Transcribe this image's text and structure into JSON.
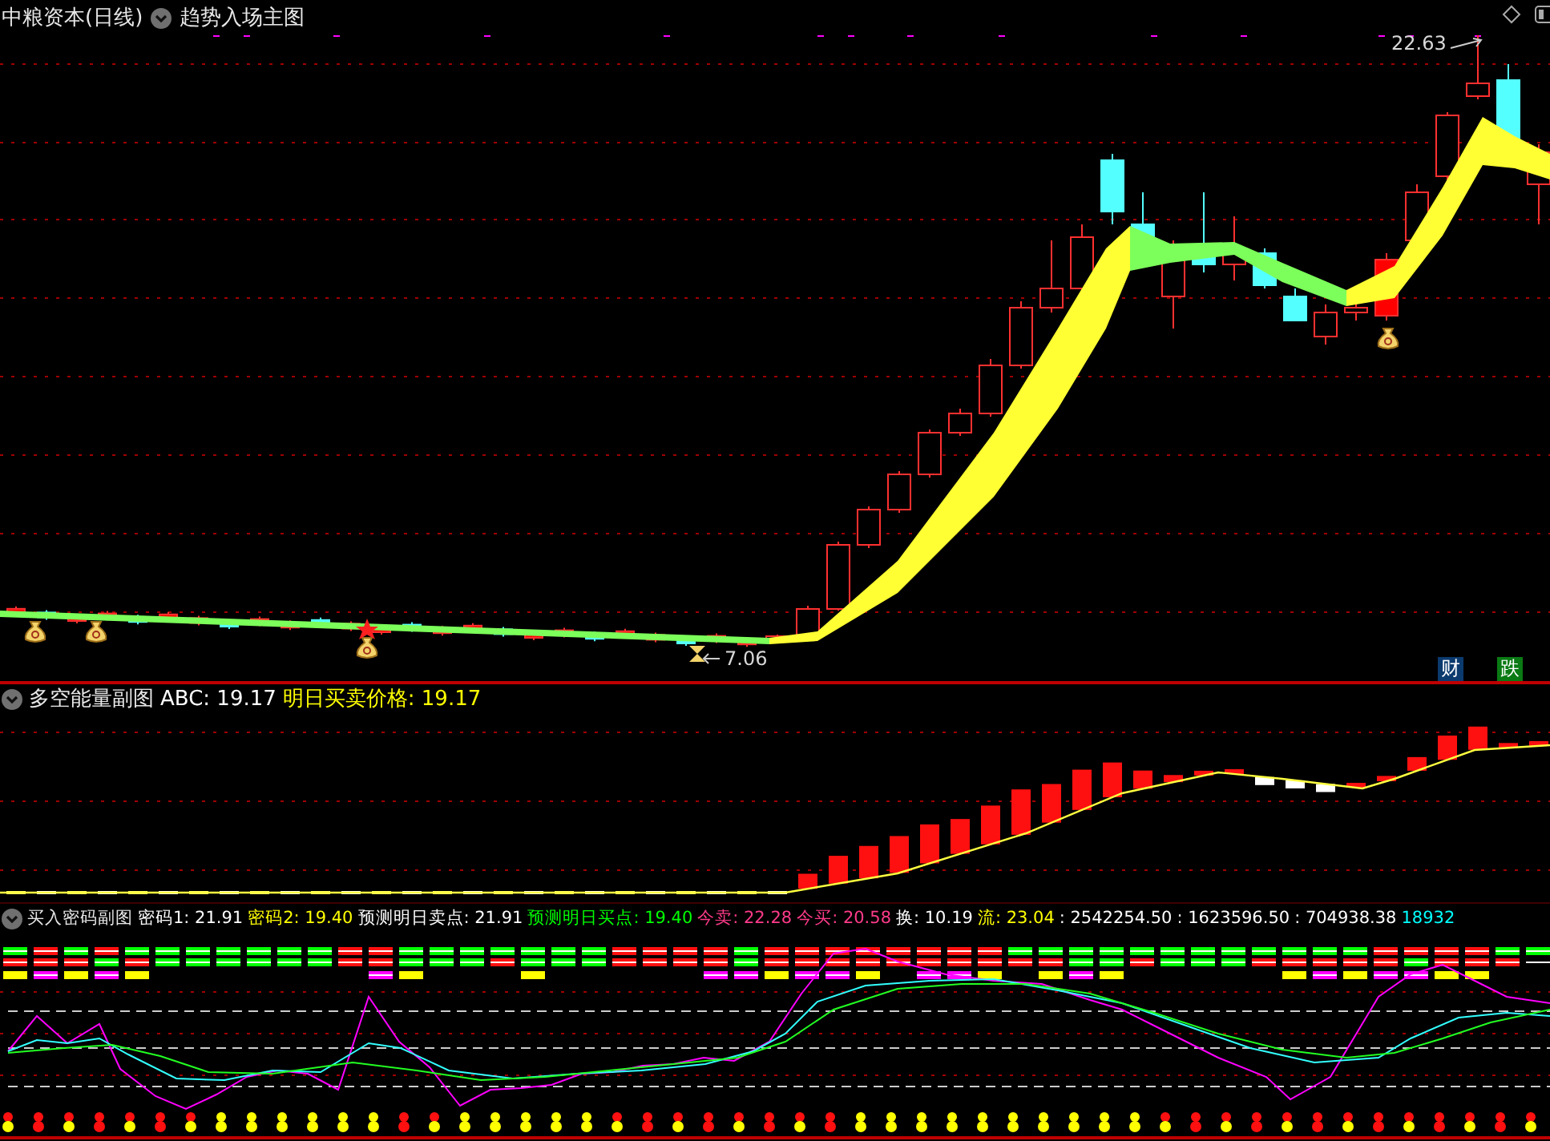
{
  "main_pane": {
    "stock_title": "中粮资本(日线)",
    "indicator": "趋势入场主图",
    "price_labels": [
      {
        "text": "22.63",
        "kind": "high"
      },
      {
        "text": "7.06",
        "kind": "low"
      }
    ],
    "badges": [
      {
        "text": "财",
        "color": "#0b3a6e"
      },
      {
        "text": "跌",
        "color": "#0a7a14"
      }
    ]
  },
  "sub_pane_1": {
    "indicator": "多空能量副图",
    "values": [
      {
        "text": "ABC: 19.17",
        "color": "#ffffff"
      },
      {
        "text": "明日买卖价格: 19.17",
        "color": "#ffff00"
      }
    ]
  },
  "sub_pane_2": {
    "indicator": "买入密码副图",
    "values": [
      {
        "text": "密码1: 21.91",
        "color": "#ffffff"
      },
      {
        "text": "密码2: 19.40",
        "color": "#ffff00"
      },
      {
        "text": "预测明日卖点: 21.91",
        "color": "#ffffff"
      },
      {
        "text": "预测明日买点: 19.40",
        "color": "#00ff00"
      },
      {
        "text": "今卖: 22.28",
        "color": "#ff3b8a"
      },
      {
        "text": "今买: 20.58",
        "color": "#ff3b8a"
      },
      {
        "text": "换: 10.19",
        "color": "#ffffff"
      },
      {
        "text": "流: 23.04",
        "color": "#ffff00"
      },
      {
        "text": ": 2542254.50",
        "color": "#ffffff"
      },
      {
        "text": ": 1623596.50",
        "color": "#ffffff"
      },
      {
        "text": ": 704938.38",
        "color": "#ffffff"
      },
      {
        "text": "18932",
        "color": "#00ffff"
      }
    ]
  }
}
